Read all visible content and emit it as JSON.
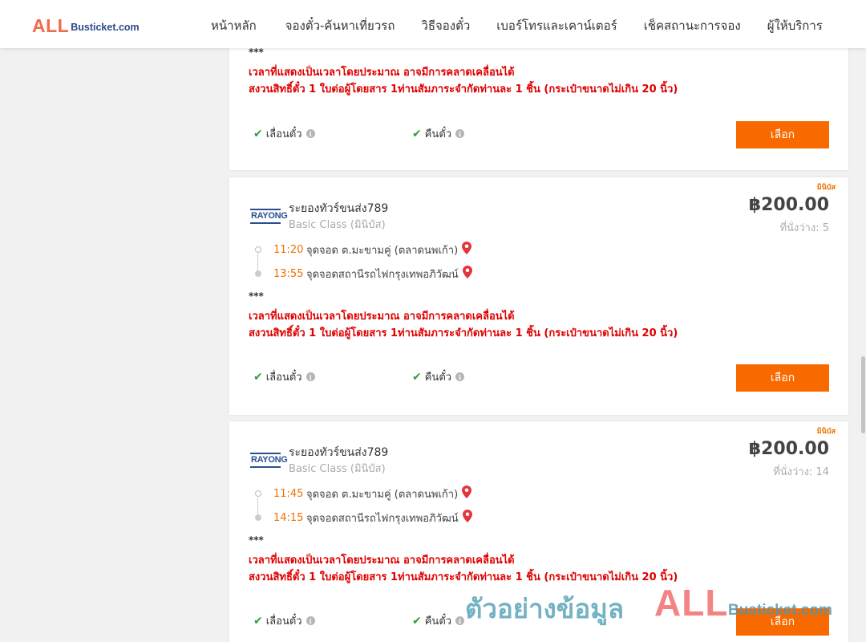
{
  "header": {
    "logo_main": "ALL",
    "logo_sub": "Busticket.com",
    "nav": [
      "หน้าหลัก",
      "จองตั๋ว-ค้นหาเที่ยวรถ",
      "วิธีจองตั๋ว",
      "เบอร์โทรและเคาน์เตอร์",
      "เช็คสถานะการจอง",
      "ผู้ให้บริการ"
    ]
  },
  "common": {
    "stars": "***",
    "note_line1": "เวลาที่แสดงเป็นเวลาโดยประมาณ อาจมีการคลาดเคลื่อนได้",
    "note_line2": "สงวนสิทธิ์ตั๋ว 1 ใบต่อผู้โดยสาร 1ท่านสัมภาระจำกัดท่านละ 1 ชิ้น (กระเป๋าขนาดไม่เกิน 20 นิ้ว)",
    "feature_reschedule": "เลื่อนตั๋ว",
    "feature_refund": "คืนตั๋ว",
    "info_glyph": "i",
    "select_label": "เลือก",
    "operator_logo_text": "RAYONG"
  },
  "trips": [
    {
      "tag": "มินิบัส",
      "operator": "ระยองทัวร์ขนส่ง789",
      "bus_class": "Basic Class (มินิบัส)",
      "price": "฿200.00",
      "seats": "ที่นั่งว่าง: 5",
      "depart_time": "11:20",
      "depart_place": "จุดจอด ต.มะขามคู่ (ตลาดนพเก้า)",
      "arrive_time": "13:55",
      "arrive_place": "จุดจอดสถานีรถไฟกรุงเทพอภิวัฒน์"
    },
    {
      "tag": "มินิบัส",
      "operator": "ระยองทัวร์ขนส่ง789",
      "bus_class": "Basic Class (มินิบัส)",
      "price": "฿200.00",
      "seats": "ที่นั่งว่าง: 14",
      "depart_time": "11:45",
      "depart_place": "จุดจอด ต.มะขามคู่ (ตลาดนพเก้า)",
      "arrive_time": "14:15",
      "arrive_place": "จุดจอดสถานีรถไฟกรุงเทพอภิวัฒน์"
    }
  ],
  "watermark": {
    "text": "ตัวอย่างข้อมูล",
    "logo_main": "ALL",
    "logo_sub": "Busticket.com"
  },
  "colors": {
    "accent": "#f86a00",
    "warning": "#e00000",
    "time": "#f07000",
    "check": "#2e9e3e"
  }
}
